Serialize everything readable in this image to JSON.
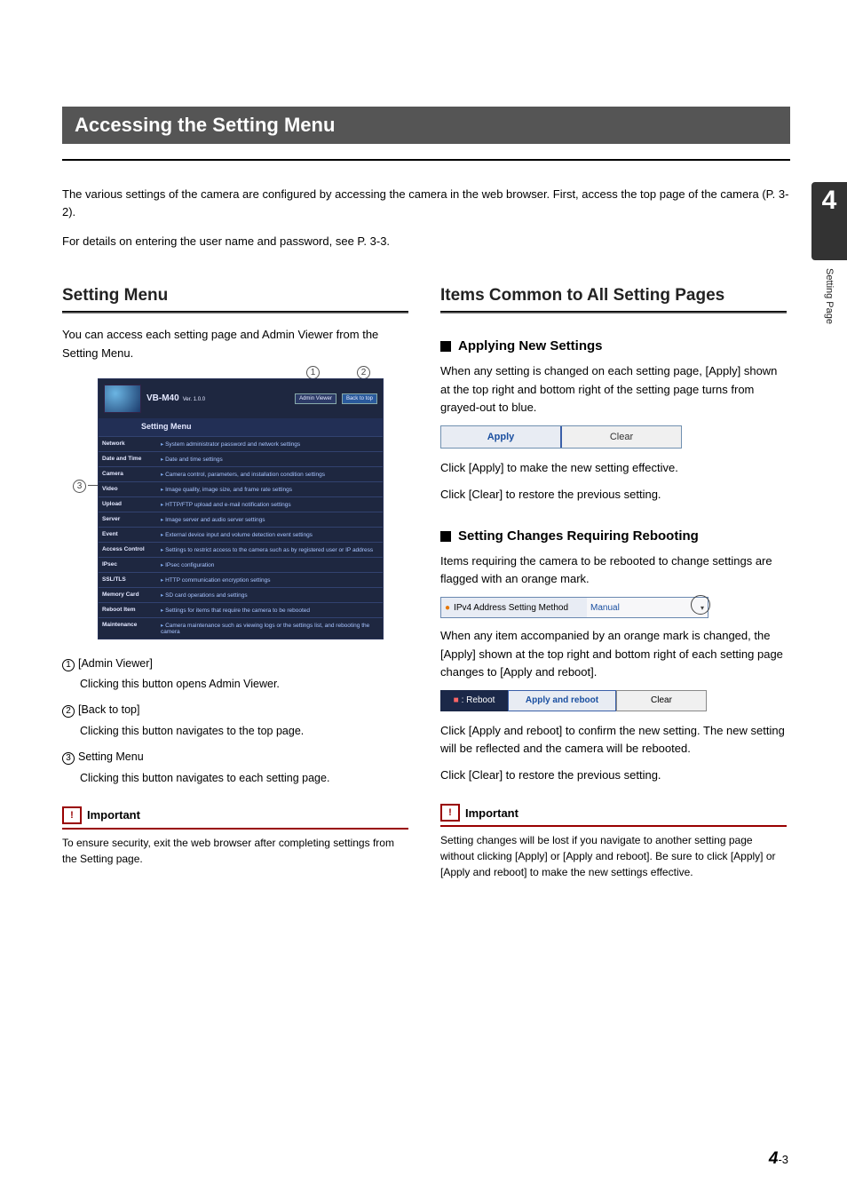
{
  "title": "Accessing the Setting Menu",
  "intro1": "The various settings of the camera are configured by accessing the camera in the web browser. First, access the top page of the camera (P. 3-2).",
  "intro2": "For details on entering the user name and password, see P. 3-3.",
  "left": {
    "heading": "Setting Menu",
    "lead": "You can access each setting page and Admin Viewer from the Setting Menu.",
    "shot": {
      "product": "VB-M40",
      "version": "Ver. 1.0.0",
      "btn_admin": "Admin Viewer",
      "btn_back": "Back to top",
      "menu_heading": "Setting Menu",
      "rows": [
        {
          "n": "Network",
          "d": "System administrator password and network settings"
        },
        {
          "n": "Date and Time",
          "d": "Date and time settings"
        },
        {
          "n": "Camera",
          "d": "Camera control, parameters, and installation condition settings"
        },
        {
          "n": "Video",
          "d": "Image quality, image size, and frame rate settings"
        },
        {
          "n": "Upload",
          "d": "HTTP/FTP upload and e-mail notification settings"
        },
        {
          "n": "Server",
          "d": "Image server and audio server settings"
        },
        {
          "n": "Event",
          "d": "External device input and volume detection event settings"
        },
        {
          "n": "Access Control",
          "d": "Settings to restrict access to the camera such as by registered user or IP address"
        },
        {
          "n": "IPsec",
          "d": "IPsec configuration"
        },
        {
          "n": "SSL/TLS",
          "d": "HTTP communication encryption settings"
        },
        {
          "n": "Memory Card",
          "d": "SD card operations and settings"
        },
        {
          "n": "Reboot Item",
          "d": "Settings for items that require the camera to be rebooted"
        },
        {
          "n": "Maintenance",
          "d": "Camera maintenance such as viewing logs or the settings list, and rebooting the camera"
        }
      ]
    },
    "items": [
      {
        "n": "1",
        "t": "[Admin Viewer]",
        "d": "Clicking this button opens Admin Viewer."
      },
      {
        "n": "2",
        "t": "[Back to top]",
        "d": "Clicking this button navigates to the top page."
      },
      {
        "n": "3",
        "t": "Setting Menu",
        "d": "Clicking this button navigates to each setting page."
      }
    ],
    "important_h": "Important",
    "important_b": "To ensure security, exit the web browser after completing settings from the Setting page."
  },
  "right": {
    "heading": "Items Common to All Setting Pages",
    "sub1": "Applying New Settings",
    "sub1_p1": "When any setting is changed on each setting page, [Apply] shown at the top right and bottom right of the setting page turns from grayed-out to blue.",
    "btn_apply": "Apply",
    "btn_clear": "Clear",
    "sub1_p2": "Click [Apply] to make the new setting effective.",
    "sub1_p3": "Click [Clear] to restore the previous setting.",
    "sub2": "Setting Changes Requiring Rebooting",
    "sub2_p1": "Items requiring the camera to be rebooted to change settings are flagged with an orange mark.",
    "ipv4_l": "IPv4 Address Setting Method",
    "ipv4_r": "Manual",
    "sub2_p2": "When any item accompanied by an orange mark is changed, the [Apply] shown at the top right and bottom right of each setting page changes to [Apply and reboot].",
    "rb_label": ": Reboot",
    "rb_apply": "Apply and reboot",
    "rb_clear": "Clear",
    "sub2_p3": "Click [Apply and reboot] to confirm the new setting. The new setting will be reflected and the camera will be rebooted.",
    "sub2_p4": "Click [Clear] to restore the previous setting.",
    "important_h": "Important",
    "important_b": "Setting changes will be lost if you navigate to another setting page without clicking [Apply] or [Apply and reboot]. Be sure to click [Apply] or [Apply and reboot] to make the new settings effective."
  },
  "sidetab_num": "4",
  "sidetab_txt": "Setting Page",
  "footer_big": "4",
  "footer_small": "-3"
}
